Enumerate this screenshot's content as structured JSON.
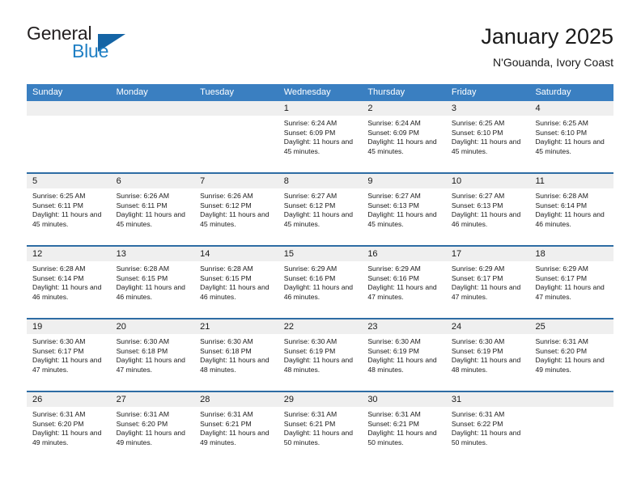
{
  "brand": {
    "name_part1": "General",
    "name_part2": "Blue",
    "accent_color": "#1f7fc4",
    "triangle_color": "#1464a5"
  },
  "header": {
    "title": "January 2025",
    "location": "N'Gouanda, Ivory Coast"
  },
  "calendar": {
    "header_bg": "#3a7fc1",
    "row_divider": "#2e6da4",
    "daynum_bg": "#efefef",
    "weekdays": [
      "Sunday",
      "Monday",
      "Tuesday",
      "Wednesday",
      "Thursday",
      "Friday",
      "Saturday"
    ],
    "weeks": [
      [
        {
          "day": "",
          "sunrise": "",
          "sunset": "",
          "daylight": "",
          "empty": true
        },
        {
          "day": "",
          "sunrise": "",
          "sunset": "",
          "daylight": "",
          "empty": true
        },
        {
          "day": "",
          "sunrise": "",
          "sunset": "",
          "daylight": "",
          "empty": true
        },
        {
          "day": "1",
          "sunrise": "Sunrise: 6:24 AM",
          "sunset": "Sunset: 6:09 PM",
          "daylight": "Daylight: 11 hours and 45 minutes."
        },
        {
          "day": "2",
          "sunrise": "Sunrise: 6:24 AM",
          "sunset": "Sunset: 6:09 PM",
          "daylight": "Daylight: 11 hours and 45 minutes."
        },
        {
          "day": "3",
          "sunrise": "Sunrise: 6:25 AM",
          "sunset": "Sunset: 6:10 PM",
          "daylight": "Daylight: 11 hours and 45 minutes."
        },
        {
          "day": "4",
          "sunrise": "Sunrise: 6:25 AM",
          "sunset": "Sunset: 6:10 PM",
          "daylight": "Daylight: 11 hours and 45 minutes."
        }
      ],
      [
        {
          "day": "5",
          "sunrise": "Sunrise: 6:25 AM",
          "sunset": "Sunset: 6:11 PM",
          "daylight": "Daylight: 11 hours and 45 minutes."
        },
        {
          "day": "6",
          "sunrise": "Sunrise: 6:26 AM",
          "sunset": "Sunset: 6:11 PM",
          "daylight": "Daylight: 11 hours and 45 minutes."
        },
        {
          "day": "7",
          "sunrise": "Sunrise: 6:26 AM",
          "sunset": "Sunset: 6:12 PM",
          "daylight": "Daylight: 11 hours and 45 minutes."
        },
        {
          "day": "8",
          "sunrise": "Sunrise: 6:27 AM",
          "sunset": "Sunset: 6:12 PM",
          "daylight": "Daylight: 11 hours and 45 minutes."
        },
        {
          "day": "9",
          "sunrise": "Sunrise: 6:27 AM",
          "sunset": "Sunset: 6:13 PM",
          "daylight": "Daylight: 11 hours and 45 minutes."
        },
        {
          "day": "10",
          "sunrise": "Sunrise: 6:27 AM",
          "sunset": "Sunset: 6:13 PM",
          "daylight": "Daylight: 11 hours and 46 minutes."
        },
        {
          "day": "11",
          "sunrise": "Sunrise: 6:28 AM",
          "sunset": "Sunset: 6:14 PM",
          "daylight": "Daylight: 11 hours and 46 minutes."
        }
      ],
      [
        {
          "day": "12",
          "sunrise": "Sunrise: 6:28 AM",
          "sunset": "Sunset: 6:14 PM",
          "daylight": "Daylight: 11 hours and 46 minutes."
        },
        {
          "day": "13",
          "sunrise": "Sunrise: 6:28 AM",
          "sunset": "Sunset: 6:15 PM",
          "daylight": "Daylight: 11 hours and 46 minutes."
        },
        {
          "day": "14",
          "sunrise": "Sunrise: 6:28 AM",
          "sunset": "Sunset: 6:15 PM",
          "daylight": "Daylight: 11 hours and 46 minutes."
        },
        {
          "day": "15",
          "sunrise": "Sunrise: 6:29 AM",
          "sunset": "Sunset: 6:16 PM",
          "daylight": "Daylight: 11 hours and 46 minutes."
        },
        {
          "day": "16",
          "sunrise": "Sunrise: 6:29 AM",
          "sunset": "Sunset: 6:16 PM",
          "daylight": "Daylight: 11 hours and 47 minutes."
        },
        {
          "day": "17",
          "sunrise": "Sunrise: 6:29 AM",
          "sunset": "Sunset: 6:17 PM",
          "daylight": "Daylight: 11 hours and 47 minutes."
        },
        {
          "day": "18",
          "sunrise": "Sunrise: 6:29 AM",
          "sunset": "Sunset: 6:17 PM",
          "daylight": "Daylight: 11 hours and 47 minutes."
        }
      ],
      [
        {
          "day": "19",
          "sunrise": "Sunrise: 6:30 AM",
          "sunset": "Sunset: 6:17 PM",
          "daylight": "Daylight: 11 hours and 47 minutes."
        },
        {
          "day": "20",
          "sunrise": "Sunrise: 6:30 AM",
          "sunset": "Sunset: 6:18 PM",
          "daylight": "Daylight: 11 hours and 47 minutes."
        },
        {
          "day": "21",
          "sunrise": "Sunrise: 6:30 AM",
          "sunset": "Sunset: 6:18 PM",
          "daylight": "Daylight: 11 hours and 48 minutes."
        },
        {
          "day": "22",
          "sunrise": "Sunrise: 6:30 AM",
          "sunset": "Sunset: 6:19 PM",
          "daylight": "Daylight: 11 hours and 48 minutes."
        },
        {
          "day": "23",
          "sunrise": "Sunrise: 6:30 AM",
          "sunset": "Sunset: 6:19 PM",
          "daylight": "Daylight: 11 hours and 48 minutes."
        },
        {
          "day": "24",
          "sunrise": "Sunrise: 6:30 AM",
          "sunset": "Sunset: 6:19 PM",
          "daylight": "Daylight: 11 hours and 48 minutes."
        },
        {
          "day": "25",
          "sunrise": "Sunrise: 6:31 AM",
          "sunset": "Sunset: 6:20 PM",
          "daylight": "Daylight: 11 hours and 49 minutes."
        }
      ],
      [
        {
          "day": "26",
          "sunrise": "Sunrise: 6:31 AM",
          "sunset": "Sunset: 6:20 PM",
          "daylight": "Daylight: 11 hours and 49 minutes."
        },
        {
          "day": "27",
          "sunrise": "Sunrise: 6:31 AM",
          "sunset": "Sunset: 6:20 PM",
          "daylight": "Daylight: 11 hours and 49 minutes."
        },
        {
          "day": "28",
          "sunrise": "Sunrise: 6:31 AM",
          "sunset": "Sunset: 6:21 PM",
          "daylight": "Daylight: 11 hours and 49 minutes."
        },
        {
          "day": "29",
          "sunrise": "Sunrise: 6:31 AM",
          "sunset": "Sunset: 6:21 PM",
          "daylight": "Daylight: 11 hours and 50 minutes."
        },
        {
          "day": "30",
          "sunrise": "Sunrise: 6:31 AM",
          "sunset": "Sunset: 6:21 PM",
          "daylight": "Daylight: 11 hours and 50 minutes."
        },
        {
          "day": "31",
          "sunrise": "Sunrise: 6:31 AM",
          "sunset": "Sunset: 6:22 PM",
          "daylight": "Daylight: 11 hours and 50 minutes."
        },
        {
          "day": "",
          "sunrise": "",
          "sunset": "",
          "daylight": "",
          "empty": true
        }
      ]
    ]
  }
}
